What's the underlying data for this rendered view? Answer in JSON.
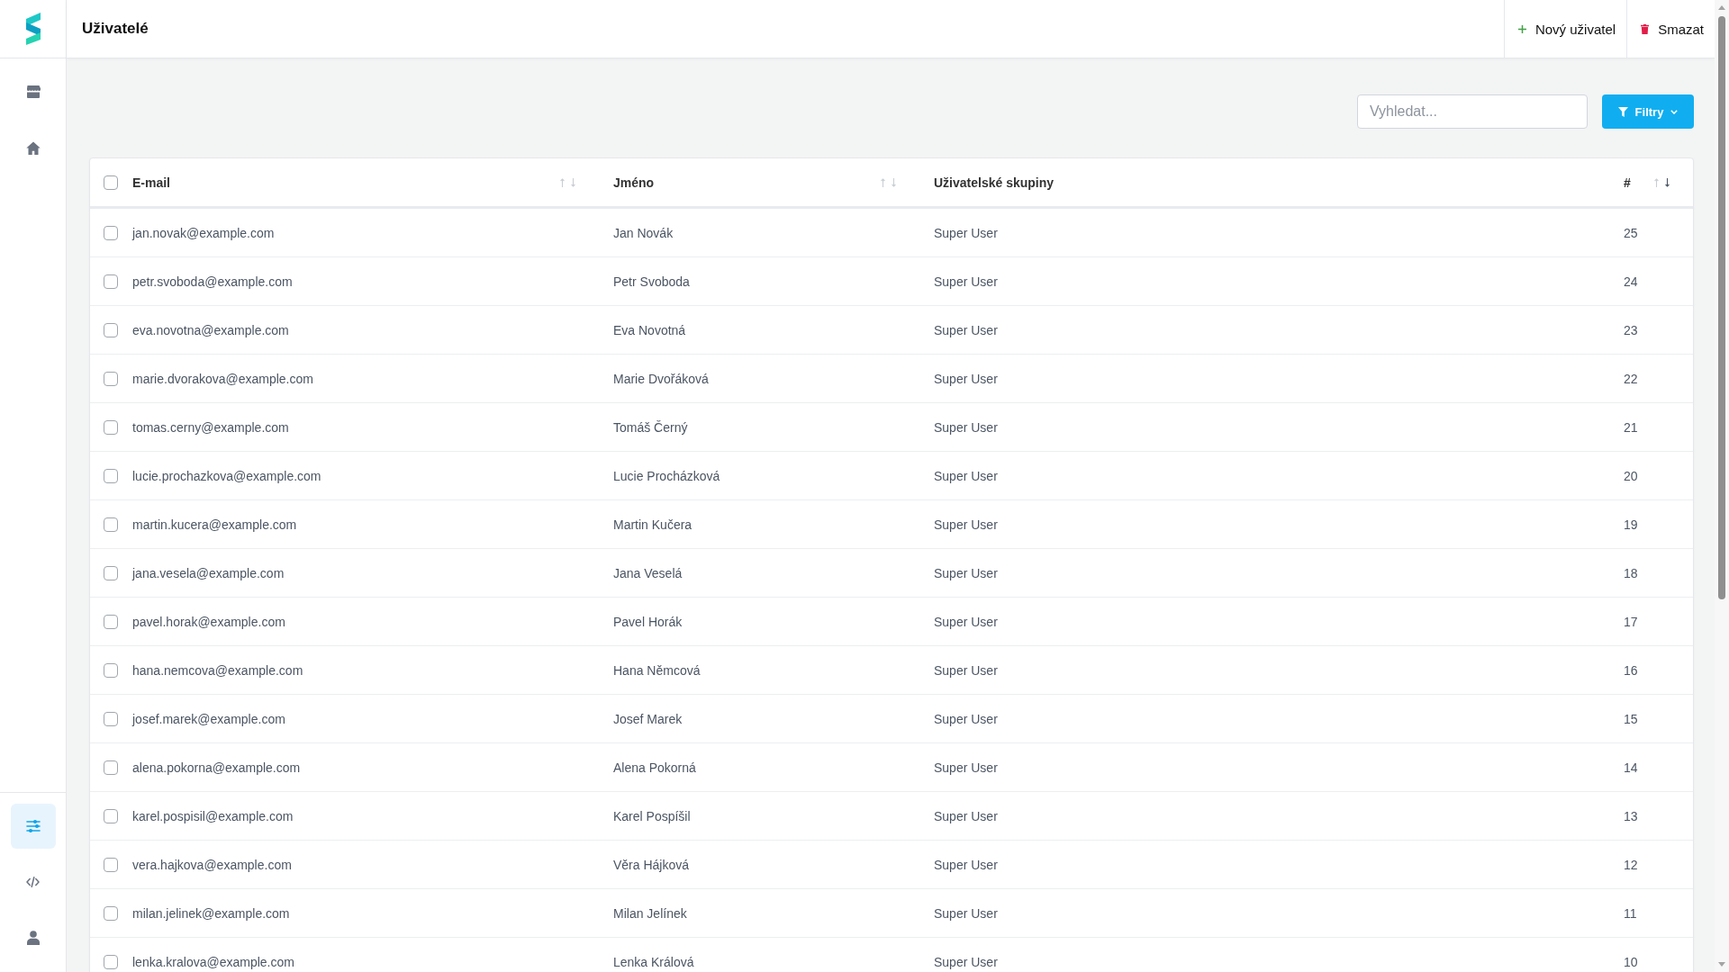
{
  "sidebar": {
    "top_items": [
      {
        "selected": false
      },
      {
        "selected": false
      }
    ],
    "bottom_items": [
      {
        "selected": true
      },
      {
        "selected": false
      },
      {
        "selected": false
      }
    ]
  },
  "header": {
    "title": "Uživatelé",
    "actions": [
      {
        "kind": "add",
        "label": "Nový uživatel"
      },
      {
        "kind": "delete",
        "label": "Smazat"
      }
    ]
  },
  "toolbar": {
    "search": {
      "placeholder": "Vyhledat..."
    },
    "filter_button": {
      "label": "Filtry"
    }
  },
  "table": {
    "select_all": {
      "checked": false
    },
    "columns": [
      {
        "label": "E-mail",
        "sortable": true,
        "sorted_descending": false
      },
      {
        "label": "Jméno",
        "sortable": true,
        "sorted_descending": false
      },
      {
        "label": "Uživatelské skupiny",
        "sortable": false
      },
      {
        "label": "#",
        "sortable": true,
        "sorted_descending": true
      }
    ],
    "rows": [
      {
        "checked": false,
        "email": "jan.novak@example.com",
        "name": "Jan Novák",
        "groups": "Super User",
        "number": "25"
      },
      {
        "checked": false,
        "email": "petr.svoboda@example.com",
        "name": "Petr Svoboda",
        "groups": "Super User",
        "number": "24"
      },
      {
        "checked": false,
        "email": "eva.novotna@example.com",
        "name": "Eva Novotná",
        "groups": "Super User",
        "number": "23"
      },
      {
        "checked": false,
        "email": "marie.dvorakova@example.com",
        "name": "Marie Dvořáková",
        "groups": "Super User",
        "number": "22"
      },
      {
        "checked": false,
        "email": "tomas.cerny@example.com",
        "name": "Tomáš Černý",
        "groups": "Super User",
        "number": "21"
      },
      {
        "checked": false,
        "email": "lucie.prochazkova@example.com",
        "name": "Lucie Procházková",
        "groups": "Super User",
        "number": "20"
      },
      {
        "checked": false,
        "email": "martin.kucera@example.com",
        "name": "Martin Kučera",
        "groups": "Super User",
        "number": "19"
      },
      {
        "checked": false,
        "email": "jana.vesela@example.com",
        "name": "Jana Veselá",
        "groups": "Super User",
        "number": "18"
      },
      {
        "checked": false,
        "email": "pavel.horak@example.com",
        "name": "Pavel Horák",
        "groups": "Super User",
        "number": "17"
      },
      {
        "checked": false,
        "email": "hana.nemcova@example.com",
        "name": "Hana Němcová",
        "groups": "Super User",
        "number": "16"
      },
      {
        "checked": false,
        "email": "josef.marek@example.com",
        "name": "Josef Marek",
        "groups": "Super User",
        "number": "15"
      },
      {
        "checked": false,
        "email": "alena.pokorna@example.com",
        "name": "Alena Pokorná",
        "groups": "Super User",
        "number": "14"
      },
      {
        "checked": false,
        "email": "karel.pospisil@example.com",
        "name": "Karel Pospíšil",
        "groups": "Super User",
        "number": "13"
      },
      {
        "checked": false,
        "email": "vera.hajkova@example.com",
        "name": "Věra Hájková",
        "groups": "Super User",
        "number": "12"
      },
      {
        "checked": false,
        "email": "milan.jelinek@example.com",
        "name": "Milan Jelínek",
        "groups": "Super User",
        "number": "11"
      },
      {
        "checked": false,
        "email": "lenka.kralova@example.com",
        "name": "Lenka Králová",
        "groups": "Super User",
        "number": "10"
      }
    ]
  }
}
